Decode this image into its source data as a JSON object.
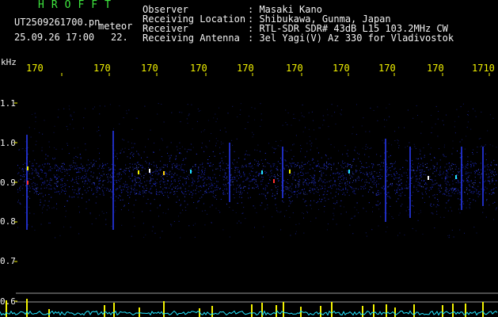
{
  "header": {
    "brand": "HROFFT",
    "file_name": "UT2509261700.pn",
    "meteor_label": "meteor",
    "datetime": "25.09.26 17:00",
    "count": "22.",
    "fields": [
      {
        "label": "Observer",
        "value": ": Masaki Kano"
      },
      {
        "label": "Receiving Location",
        "value": ": Shibukawa, Gunma, Japan"
      },
      {
        "label": "Receiver",
        "value": ": RTL-SDR SDR# 43dB L15 103.2MHz CW"
      },
      {
        "label": "Receiving Antenna",
        "value": ": 3el Yagi(V) Az 330 for Vladivostok"
      }
    ]
  },
  "axis": {
    "unit": "kHz",
    "x_ticks": [
      "170",
      "170",
      "170",
      "170",
      "170",
      "170",
      "170",
      "170",
      "170",
      "1710"
    ],
    "y_ticks": [
      "1.1",
      "1.0",
      "0.9",
      "0.8",
      "0.7",
      "0.6"
    ]
  },
  "colors": {
    "background": "#000000",
    "header_green": "#3ee63e",
    "header_white": "#f2f2f2",
    "tick_yellow": "#f2f200",
    "signal_blue": "#2a3cff",
    "level_cyan": "#22e6ff"
  }
}
